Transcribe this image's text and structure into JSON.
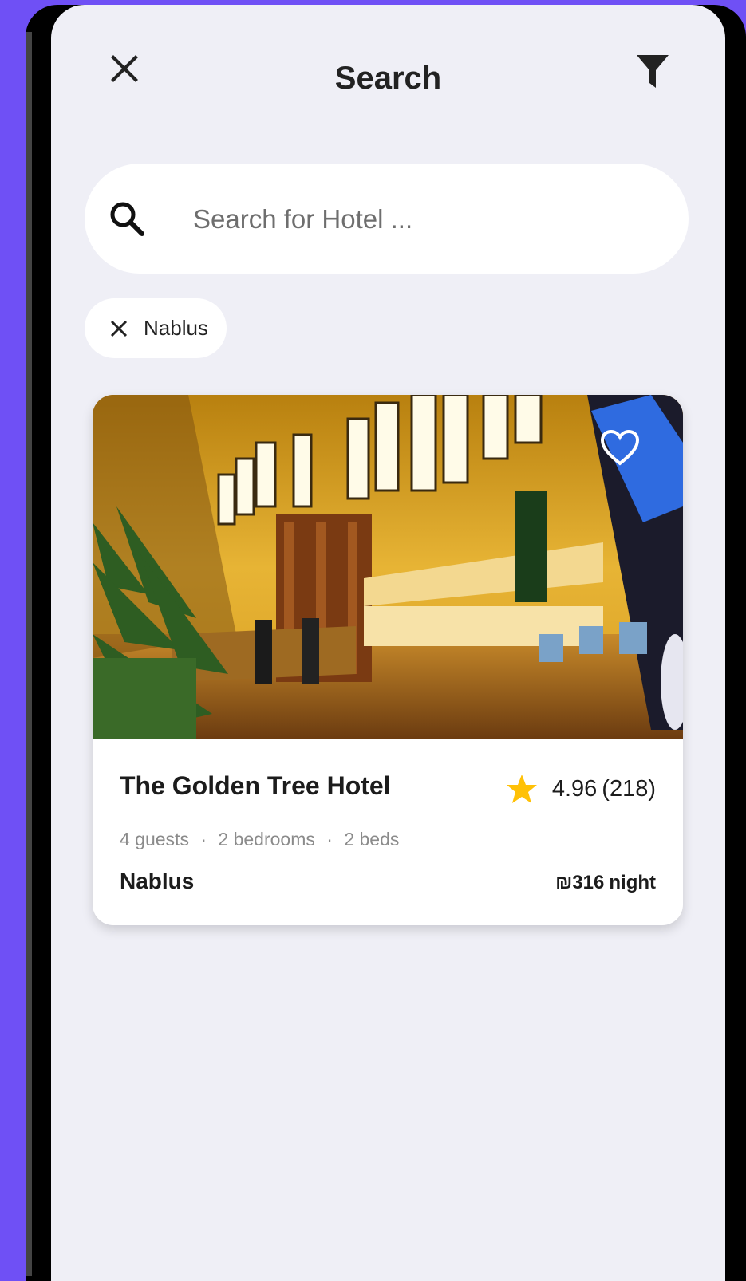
{
  "header": {
    "title": "Search",
    "close_icon": "close-icon",
    "filter_icon": "filter-icon"
  },
  "search": {
    "placeholder": "Search for Hotel ...",
    "value": "",
    "icon": "search-icon"
  },
  "filters": {
    "chips": [
      {
        "label": "Nablus",
        "remove_icon": "close-icon"
      }
    ]
  },
  "results": [
    {
      "name": "The Golden Tree Hotel",
      "rating": "4.96",
      "reviews": "(218)",
      "guests": "4 guests",
      "bedrooms": "2 bedrooms",
      "beds": "2 beds",
      "separator": "·",
      "location": "Nablus",
      "price": "₪316",
      "price_unit": "night",
      "favorite_icon": "heart-outline-icon",
      "rating_icon": "star-icon"
    }
  ],
  "colors": {
    "background": "#6f50f5",
    "screen": "#efeff6",
    "star": "#ffc107",
    "text": "#1c1c1c"
  }
}
